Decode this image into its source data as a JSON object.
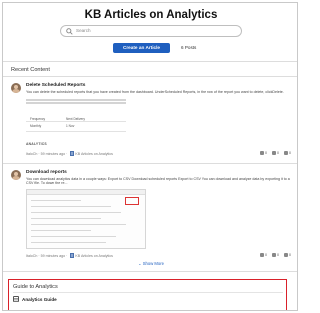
{
  "header": {
    "title": "KB Articles on Analytics",
    "search_placeholder": "Search",
    "create_button": "Create an Article",
    "posts_count": "6 Posts"
  },
  "recent": {
    "section_title": "Recent Content",
    "posts": [
      {
        "title": "Delete Scheduled Reports",
        "body": "You can delete the scheduled reports that you have created from the dashboard. UnderScheduled Reports, in the row of the report you want to delete, clickDelete.",
        "table": {
          "headers": [
            "Frequency",
            "Next Delivery"
          ],
          "rows": [
            [
              "Monthly",
              "1 Nov"
            ]
          ]
        },
        "tag": "ANALYTICS",
        "meta_prefix": "ItaloCh · 59 minutes ago · ",
        "meta_location": "KB Articles on Analytics",
        "stats": {
          "views": "0",
          "likes": "0",
          "comments": "0"
        }
      },
      {
        "title": "Download reports",
        "body": "You can download analytics data in a couple ways: Export to CSV Download scheduled reports Export to CSV You can download and analyze data by exporting it to a CSV file. To down the re...",
        "meta_prefix": "ItaloCh · 59 minutes ago · ",
        "meta_location": "KB Articles on Analytics",
        "stats": {
          "views": "0",
          "likes": "0",
          "comments": "0"
        }
      }
    ],
    "show_more": "Show More"
  },
  "guide": {
    "title": "Guide to Analytics",
    "items": [
      {
        "label": "Analytics Guide"
      }
    ]
  },
  "colors": {
    "primary": "#1f5fbf",
    "highlight_border": "#d9212a"
  }
}
